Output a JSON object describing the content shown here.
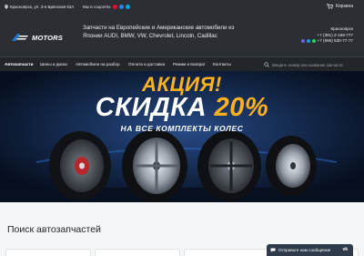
{
  "topbar": {
    "address": "Красноярск, ул. 3-я Брянская 63А",
    "social_label": "Мы в соцсетях",
    "cart_label": "Корзина",
    "social_colors": [
      "#ff0033",
      "#2787f5",
      "#00a3e0"
    ]
  },
  "header": {
    "logo_text": "MOTORS",
    "tagline": "Запчасти на Европейские и Американские автомобили из Японии AUDI, BMW, VW, Chevrolet, Lincoln, Cadillac",
    "city": "Красноярск",
    "phone_1": "+7 (391) 2-199-777",
    "phone_2": "+7 (995) 530-77-77",
    "messenger_colors": [
      "#7360f2",
      "#00a3e0",
      "#25d366"
    ]
  },
  "nav": {
    "items": [
      {
        "label": "Автозапчасти",
        "active": true
      },
      {
        "label": "Шины и диски",
        "active": false
      },
      {
        "label": "Автомобили на разбор",
        "active": false
      },
      {
        "label": "Оплата и доставка",
        "active": false
      },
      {
        "label": "Режим и возврат",
        "active": false
      },
      {
        "label": "Контакты",
        "active": false
      }
    ],
    "search_placeholder": "Введите номер или название запчасти"
  },
  "banner": {
    "line1": "АКЦИЯ!",
    "line2": "СКИДКА",
    "line2_pct": "20%",
    "line3": "НА ВСЕ КОМПЛЕКТЫ КОЛЕС"
  },
  "section": {
    "title": "Поиск автозапчастей"
  },
  "chat": {
    "label": "Отправьте нам сообщение",
    "brand": "vk"
  },
  "colors": {
    "header_bg": "#2b2f34",
    "nav_bg": "#22262a",
    "accent": "#ffb21e",
    "logo_blue": "#1e7ad6"
  }
}
